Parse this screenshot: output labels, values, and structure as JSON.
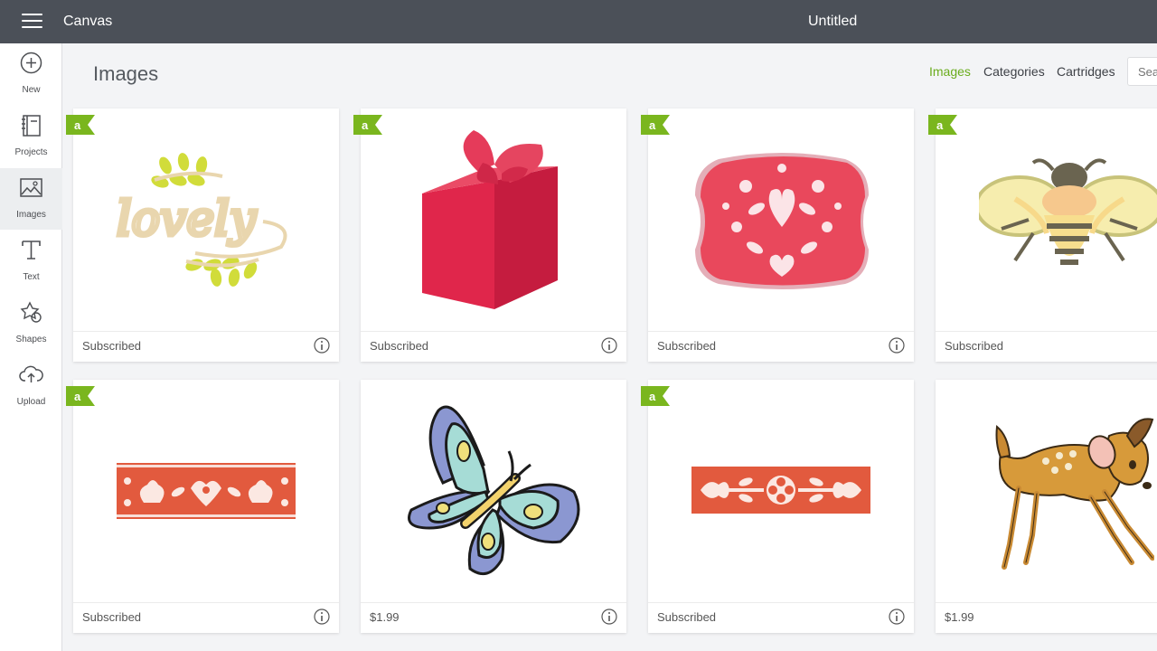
{
  "topbar": {
    "app_title": "Canvas",
    "doc_title": "Untitled"
  },
  "sidebar": {
    "items": [
      {
        "label": "New",
        "icon": "plus-circle-icon"
      },
      {
        "label": "Projects",
        "icon": "notebook-icon"
      },
      {
        "label": "Images",
        "icon": "image-icon"
      },
      {
        "label": "Text",
        "icon": "text-t-icon"
      },
      {
        "label": "Shapes",
        "icon": "shapes-icon"
      },
      {
        "label": "Upload",
        "icon": "cloud-upload-icon"
      }
    ],
    "active": "Images"
  },
  "main": {
    "title": "Images",
    "tabs": [
      {
        "label": "Images",
        "active": true
      },
      {
        "label": "Categories",
        "active": false
      },
      {
        "label": "Cartridges",
        "active": false
      }
    ],
    "search_placeholder": "Sea",
    "accent_color": "#6aac1d"
  },
  "cards": [
    {
      "label": "Subscribed",
      "access_badge": true,
      "art": "lovely-script-with-leaves"
    },
    {
      "label": "Subscribed",
      "access_badge": true,
      "art": "red-gift-box-with-butterfly"
    },
    {
      "label": "Subscribed",
      "access_badge": true,
      "art": "folk-floral-plaque"
    },
    {
      "label": "Subscribed",
      "access_badge": true,
      "art": "bee"
    },
    {
      "label": "Subscribed",
      "access_badge": true,
      "art": "folk-border-bunnies"
    },
    {
      "label": "$1.99",
      "access_badge": false,
      "art": "blue-butterfly"
    },
    {
      "label": "Subscribed",
      "access_badge": true,
      "art": "folk-border-flower"
    },
    {
      "label": "$1.99",
      "access_badge": false,
      "art": "fawn"
    }
  ]
}
